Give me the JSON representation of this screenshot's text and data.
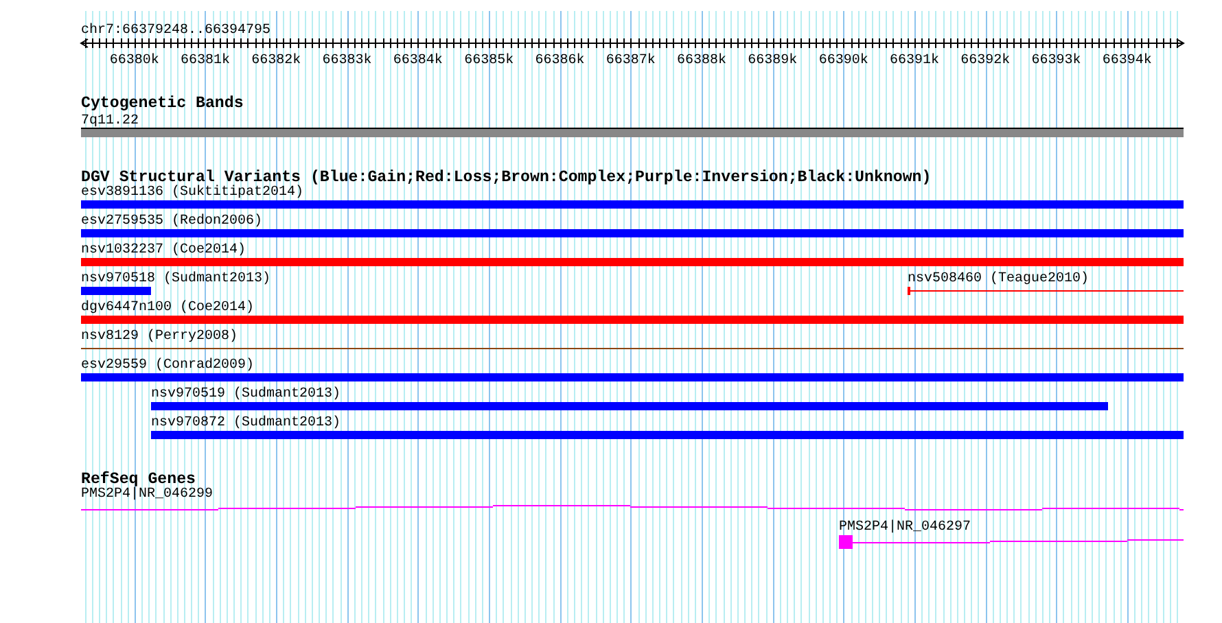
{
  "ruler": {
    "label": "chr7:66379248..66394795",
    "ticks": [
      "66380k",
      "66381k",
      "66382k",
      "66383k",
      "66384k",
      "66385k",
      "66386k",
      "66387k",
      "66388k",
      "66389k",
      "66390k",
      "66391k",
      "66392k",
      "66393k",
      "66394k"
    ]
  },
  "cytoband_track": {
    "title": "Cytogenetic Bands",
    "band": "7q11.22"
  },
  "dgv_track": {
    "title": "DGV Structural Variants (Blue:Gain;Red:Loss;Brown:Complex;Purple:Inversion;Black:Unknown)",
    "rows": [
      [
        {
          "label": "esv3891136 (Suktitipat2014)",
          "color": "#0000ff",
          "kind": "thick"
        }
      ],
      [
        {
          "label": "esv2759535 (Redon2006)",
          "color": "#0000ff",
          "kind": "thick"
        }
      ],
      [
        {
          "label": "nsv1032237 (Coe2014)",
          "color": "#ff0000",
          "kind": "thick"
        }
      ],
      [
        {
          "label": "nsv970518 (Sudmant2013)",
          "color": "#0000ff",
          "kind": "thick"
        },
        {
          "label": "nsv508460 (Teague2010)",
          "color": "#ff0000",
          "kind": "thin"
        }
      ],
      [
        {
          "label": "dgv6447n100 (Coe2014)",
          "color": "#ff0000",
          "kind": "thick"
        }
      ],
      [
        {
          "label": "nsv8129 (Perry2008)",
          "color": "#8b4513",
          "kind": "thin"
        }
      ],
      [
        {
          "label": "esv29559 (Conrad2009)",
          "color": "#0000ff",
          "kind": "thick"
        }
      ],
      [
        {
          "label": "nsv970519 (Sudmant2013)",
          "color": "#0000ff",
          "kind": "thick"
        }
      ],
      [
        {
          "label": "nsv970872 (Sudmant2013)",
          "color": "#0000ff",
          "kind": "thick"
        }
      ]
    ]
  },
  "refseq_track": {
    "title": "RefSeq Genes",
    "genes": [
      {
        "label": "PMS2P4|NR_046299"
      },
      {
        "label": "PMS2P4|NR_046297"
      }
    ]
  }
}
